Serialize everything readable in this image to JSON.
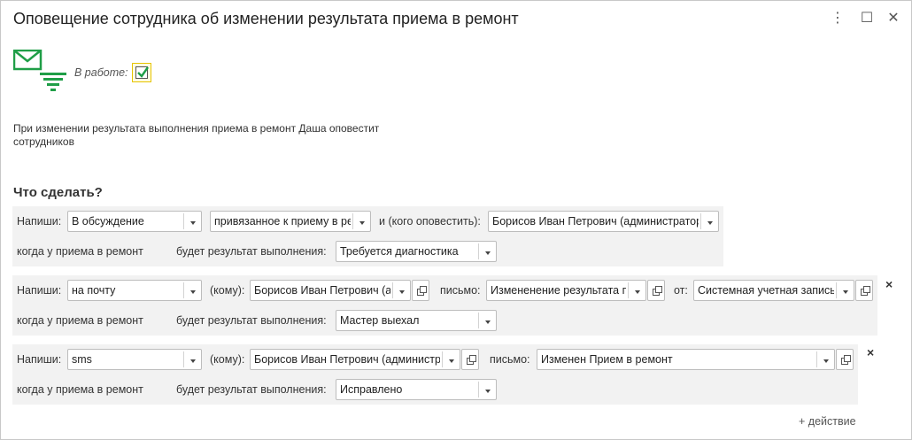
{
  "window": {
    "title": "Оповещение сотрудника об изменении результата приема в ремонт",
    "more_icon": "⋮",
    "maximize_icon": "☐",
    "close_icon": "✕"
  },
  "status": {
    "in_work_label": "В работе:",
    "in_work_checked": true
  },
  "description": "При изменении результата выполнения приема в ремонт Даша оповестит сотрудников",
  "section_title": "Что сделать?",
  "actions": [
    {
      "write_label": "Напиши:",
      "channel": "В обсуждение",
      "related": "привязанное к приему в ремонт",
      "whom_label": "и (кого оповестить):",
      "recipient": "Борисов Иван Петрович (администратор)",
      "when_label": "когда у приема в ремонт",
      "result_label": "будет результат выполнения:",
      "result": "Требуется диагностика"
    },
    {
      "write_label": "Напиши:",
      "channel": "на почту",
      "whom_label": "(кому):",
      "recipient": "Борисов Иван Петрович (администратор)",
      "letter_label": "письмо:",
      "letter": "Измененение результата приема",
      "from_label": "от:",
      "sender": "Системная учетная запись",
      "when_label": "когда у приема в ремонт",
      "result_label": "будет результат выполнения:",
      "result": "Мастер выехал",
      "delete_icon": "×"
    },
    {
      "write_label": "Напиши:",
      "channel": "sms",
      "whom_label": "(кому):",
      "recipient": "Борисов Иван Петрович (администратор)",
      "letter_label": "письмо:",
      "letter": "Изменен Прием в ремонт",
      "when_label": "когда у приема в ремонт",
      "result_label": "будет результат выполнения:",
      "result": "Исправлено",
      "delete_icon": "×"
    }
  ],
  "add_action": "+ действие",
  "colors": {
    "logo_green": "#1f9e47",
    "checkbox_highlight": "#e6c400",
    "block_bg": "#f2f2f2"
  }
}
